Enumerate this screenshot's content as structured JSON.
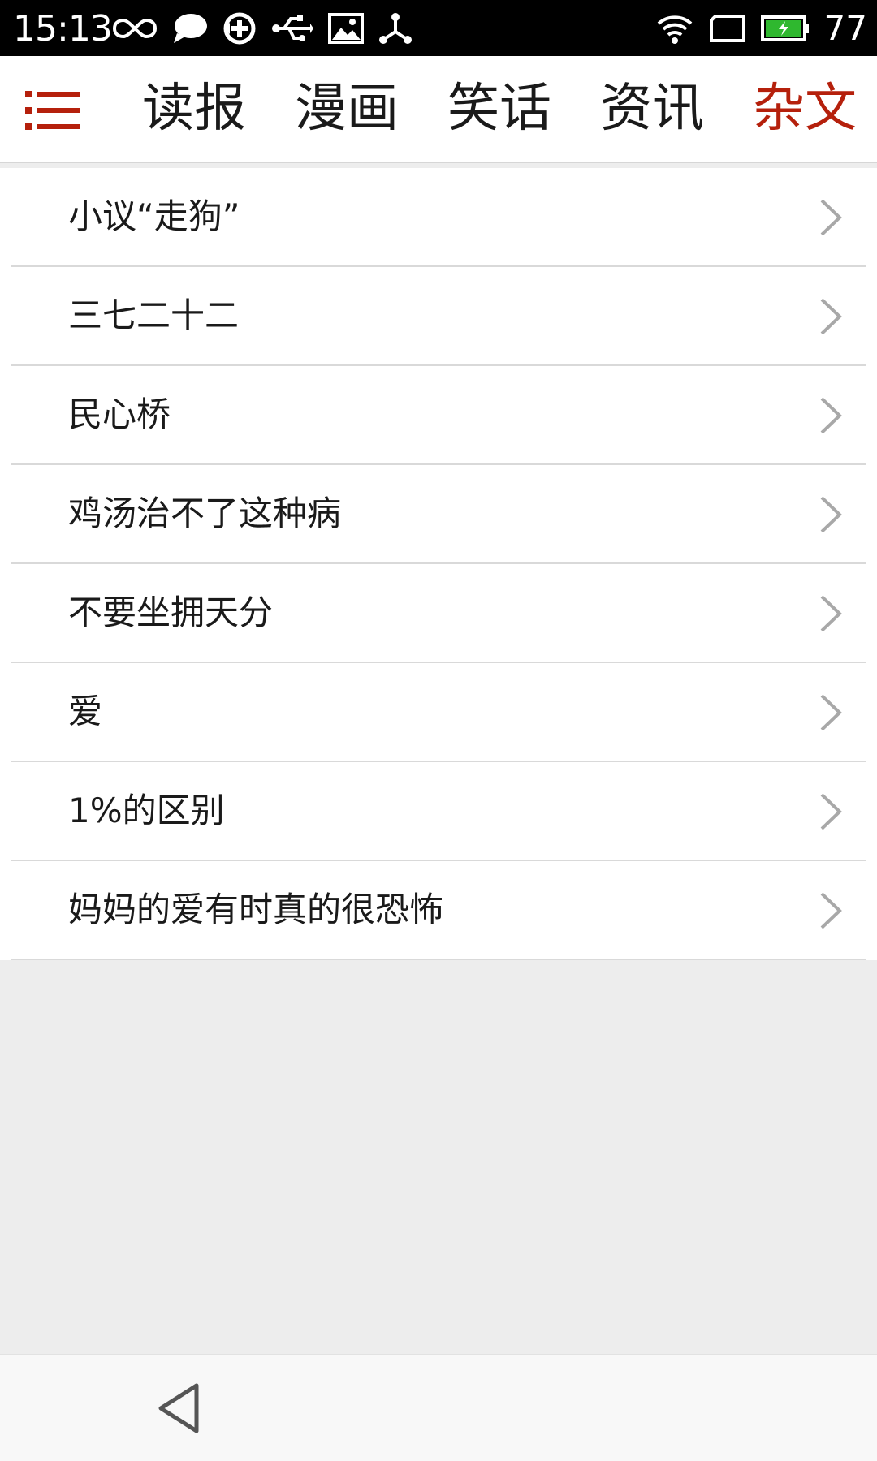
{
  "status_bar": {
    "time": "15:13",
    "battery_level": "77",
    "icons_left": [
      "infinity-icon",
      "chat-bubble-icon",
      "sync-icon",
      "usb-icon",
      "image-icon",
      "share-icon"
    ],
    "icons_right": [
      "wifi-icon",
      "screen-frame-icon",
      "battery-icon"
    ]
  },
  "top_nav": {
    "menu_icon": "hamburger-menu-icon",
    "tabs": [
      {
        "label": "读报",
        "active": false
      },
      {
        "label": "漫画",
        "active": false
      },
      {
        "label": "笑话",
        "active": false
      },
      {
        "label": "资讯",
        "active": false
      },
      {
        "label": "杂文",
        "active": true
      }
    ]
  },
  "list": {
    "items": [
      {
        "title": "小议“走狗”"
      },
      {
        "title": "三七二十二"
      },
      {
        "title": "民心桥"
      },
      {
        "title": "鸡汤治不了这种病"
      },
      {
        "title": "不要坐拥天分"
      },
      {
        "title": "爱"
      },
      {
        "title": "1%的区别"
      },
      {
        "title": "妈妈的爱有时真的很恐怖"
      }
    ]
  },
  "bottom_bar": {
    "back_icon": "back-triangle-icon"
  },
  "colors": {
    "accent": "#b5200c",
    "text": "#1a1a1a",
    "divider": "#d9d9d9",
    "background": "#ededed",
    "status_bar": "#000000"
  }
}
